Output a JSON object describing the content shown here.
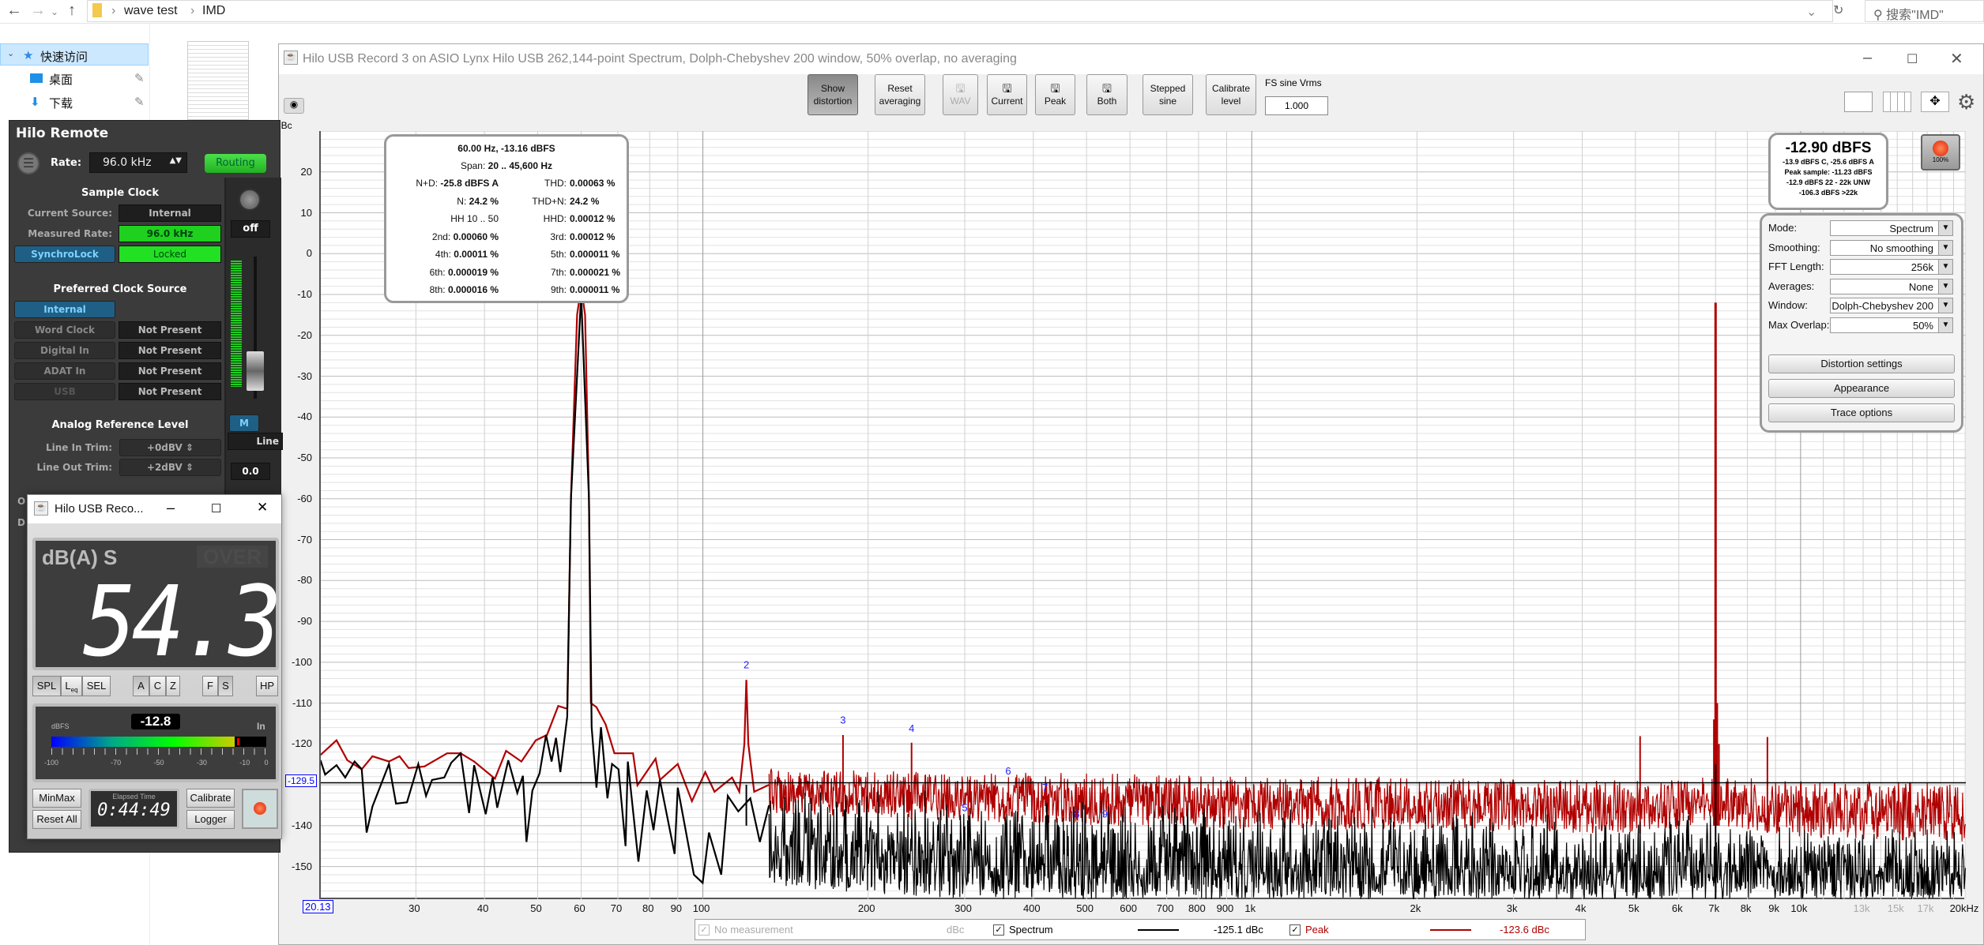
{
  "explorer": {
    "breadcrumb": [
      "wave test",
      "IMD"
    ],
    "search_placeholder": "搜索\"IMD\"",
    "nav": [
      {
        "label": "快速访问",
        "icon": "star-icon"
      },
      {
        "label": "桌面",
        "icon": "desktop-icon"
      },
      {
        "label": "下载",
        "icon": "download-icon"
      }
    ]
  },
  "main": {
    "title": "Hilo USB Record 3 on ASIO Lynx Hilo USB 262,144-point Spectrum, Dolph-Chebyshev 200 window, 50% overlap, no averaging",
    "toolbar": [
      {
        "l1": "Show",
        "l2": "distortion",
        "state": "pressed"
      },
      {
        "l1": "Reset",
        "l2": "averaging",
        "state": "normal"
      },
      {
        "l1": "",
        "l2": "WAV",
        "state": "disabled",
        "icon": "save-icon"
      },
      {
        "l1": "",
        "l2": "Current",
        "state": "normal",
        "icon": "save-icon"
      },
      {
        "l1": "",
        "l2": "Peak",
        "state": "normal",
        "icon": "save-icon"
      },
      {
        "l1": "",
        "l2": "Both",
        "state": "normal",
        "icon": "save-icon"
      },
      {
        "l1": "Stepped",
        "l2": "sine",
        "state": "normal"
      },
      {
        "l1": "Calibrate",
        "l2": "level",
        "state": "normal"
      }
    ],
    "fs_label": "FS sine Vrms",
    "fs_value": "1.000",
    "distortion": {
      "header": "60.00 Hz, -13.16 dBFS",
      "span_label": "Span:",
      "span": "20 .. 45,600 Hz",
      "rows": [
        [
          {
            "k": "N+D:",
            "v": "-25.8 dBFS A"
          },
          {
            "k": "THD:",
            "v": "0.00063 %"
          }
        ],
        [
          {
            "k": "N:",
            "v": "24.2 %"
          },
          {
            "k": "THD+N:",
            "v": "24.2 %"
          }
        ],
        [
          {
            "k": "HH 10 .. 50",
            "v": ""
          },
          {
            "k": "HHD:",
            "v": "0.00012 %"
          }
        ],
        [
          {
            "k": "2nd:",
            "v": "0.00060 %"
          },
          {
            "k": "3rd:",
            "v": "0.00012 %"
          }
        ],
        [
          {
            "k": "4th:",
            "v": "0.00011 %"
          },
          {
            "k": "5th:",
            "v": "0.000011 %"
          }
        ],
        [
          {
            "k": "6th:",
            "v": "0.000019 %"
          },
          {
            "k": "7th:",
            "v": "0.000021 %"
          }
        ],
        [
          {
            "k": "8th:",
            "v": "0.000016 %"
          },
          {
            "k": "9th:",
            "v": "0.000011 %"
          }
        ]
      ]
    },
    "level": {
      "main": "-12.90 dBFS",
      "lines": [
        "-13.9 dBFS C, -25.6 dBFS A",
        "Peak sample: -11.23 dBFS",
        "-12.9 dBFS 22 - 22k UNW",
        "-106.3 dBFS >22k"
      ]
    },
    "record_pct": "100%",
    "controls": [
      {
        "label": "Mode:",
        "value": "Spectrum"
      },
      {
        "label": "Smoothing:",
        "value": "No  smoothing"
      },
      {
        "label": "FFT Length:",
        "value": "256k"
      },
      {
        "label": "Averages:",
        "value": "None"
      },
      {
        "label": "Window:",
        "value": "Dolph-Chebyshev 200"
      },
      {
        "label": "Max Overlap:",
        "value": "50%"
      }
    ],
    "panel_buttons": [
      "Distortion settings",
      "Appearance",
      "Trace options"
    ],
    "legend": {
      "none_label": "No measurement",
      "none_unit": "dBc",
      "items": [
        {
          "name": "Spectrum",
          "value": "-125.1 dBc",
          "color": "#000000",
          "checked": true
        },
        {
          "name": "Peak",
          "value": "-123.6 dBc",
          "color": "#b00000",
          "checked": true
        }
      ]
    }
  },
  "chart_data": {
    "type": "line",
    "xscale": "log",
    "xlim": [
      20.13,
      20000
    ],
    "ylim": [
      -158,
      30
    ],
    "grid": true,
    "ylabel": "dBc",
    "y_ticks": [
      20,
      10,
      0,
      -10,
      -20,
      -30,
      -40,
      -50,
      -60,
      -70,
      -80,
      -90,
      -100,
      -110,
      -120,
      -140,
      -150
    ],
    "x_ticks": [
      {
        "v": 30,
        "label": "30"
      },
      {
        "v": 40,
        "label": "40"
      },
      {
        "v": 50,
        "label": "50"
      },
      {
        "v": 60,
        "label": "60"
      },
      {
        "v": 70,
        "label": "70"
      },
      {
        "v": 80,
        "label": "80"
      },
      {
        "v": 90,
        "label": "90"
      },
      {
        "v": 100,
        "label": "100"
      },
      {
        "v": 200,
        "label": "200"
      },
      {
        "v": 300,
        "label": "300"
      },
      {
        "v": 400,
        "label": "400"
      },
      {
        "v": 500,
        "label": "500"
      },
      {
        "v": 600,
        "label": "600"
      },
      {
        "v": 700,
        "label": "700"
      },
      {
        "v": 800,
        "label": "800"
      },
      {
        "v": 900,
        "label": "900"
      },
      {
        "v": 1000,
        "label": "1k"
      },
      {
        "v": 2000,
        "label": "2k"
      },
      {
        "v": 3000,
        "label": "3k"
      },
      {
        "v": 4000,
        "label": "4k"
      },
      {
        "v": 5000,
        "label": "5k"
      },
      {
        "v": 6000,
        "label": "6k"
      },
      {
        "v": 7000,
        "label": "7k"
      },
      {
        "v": 8000,
        "label": "8k"
      },
      {
        "v": 9000,
        "label": "9k"
      },
      {
        "v": 10000,
        "label": "10k"
      },
      {
        "v": 13000,
        "label": "13k",
        "dim": true
      },
      {
        "v": 15000,
        "label": "15k",
        "dim": true
      },
      {
        "v": 17000,
        "label": "17k",
        "dim": true
      },
      {
        "v": 20000,
        "label": "20kHz"
      }
    ],
    "reference_line": {
      "value": -129.5,
      "label": "-129.5"
    },
    "x_cursor": {
      "value": 20.13,
      "label": "20.13"
    },
    "series": [
      {
        "name": "Peak",
        "color": "#b00000",
        "points": [
          [
            20.1,
            -122.7
          ],
          [
            21.5,
            -119.1
          ],
          [
            22.5,
            -124
          ],
          [
            23.9,
            -126.2
          ],
          [
            25,
            -123
          ],
          [
            26.8,
            -124.3
          ],
          [
            28,
            -123
          ],
          [
            29.1,
            -125.9
          ],
          [
            31.1,
            -125.5
          ],
          [
            34.2,
            -122.3
          ],
          [
            36.2,
            -122.3
          ],
          [
            38.3,
            -124.3
          ],
          [
            41.8,
            -128.5
          ],
          [
            43.8,
            -121.7
          ],
          [
            46.7,
            -124.3
          ],
          [
            49.6,
            -119.1
          ],
          [
            52,
            -117.8
          ],
          [
            54.5,
            -110.7
          ],
          [
            56.6,
            -111.4
          ],
          [
            57.5,
            -60
          ],
          [
            59,
            -15
          ],
          [
            60,
            -8
          ],
          [
            61,
            -15
          ],
          [
            62,
            -60
          ],
          [
            62.5,
            -110
          ],
          [
            64,
            -111
          ],
          [
            66.5,
            -115.2
          ],
          [
            69,
            -122.3
          ],
          [
            74.6,
            -122.3
          ],
          [
            76,
            -130.1
          ],
          [
            82,
            -123.6
          ],
          [
            83.5,
            -128.8
          ],
          [
            90,
            -124.9
          ],
          [
            95.5,
            -134
          ],
          [
            101,
            -126.9
          ],
          [
            105,
            -131.7
          ],
          [
            113,
            -128.2
          ],
          [
            116.5,
            -131.7
          ],
          [
            119,
            -120
          ],
          [
            120,
            -104.3
          ],
          [
            121,
            -120
          ],
          [
            124,
            -131.7
          ],
          [
            132,
            -130
          ]
        ],
        "noise_band": [
          [
            132,
            -126,
            -137
          ],
          [
            300,
            -127,
            -139
          ],
          [
            500,
            -127,
            -140
          ],
          [
            1000,
            -128,
            -141
          ],
          [
            2000,
            -128,
            -141
          ],
          [
            5000,
            -129,
            -142
          ],
          [
            6800,
            -128,
            -140
          ],
          [
            7200,
            -128,
            -140
          ],
          [
            10000,
            -129,
            -143
          ],
          [
            20000,
            -129,
            -144
          ]
        ],
        "spikes": [
          [
            180,
            -117.8
          ],
          [
            240,
            -119.7
          ],
          [
            5100,
            -118.1
          ],
          [
            6950,
            -114
          ],
          [
            7000,
            -12
          ],
          [
            7050,
            -110
          ],
          [
            7100,
            -120
          ],
          [
            8700,
            -118.3
          ]
        ]
      },
      {
        "name": "Spectrum",
        "color": "#000000",
        "points": [
          [
            20.1,
            -124
          ],
          [
            20.5,
            -127.5
          ],
          [
            21.5,
            -125.2
          ],
          [
            22.3,
            -128.2
          ],
          [
            23.2,
            -124.3
          ],
          [
            23.9,
            -126.2
          ],
          [
            24.4,
            -141.7
          ],
          [
            25,
            -135.3
          ],
          [
            26.8,
            -124.9
          ],
          [
            27.6,
            -134.6
          ],
          [
            28.9,
            -134.3
          ],
          [
            30.3,
            -124.9
          ],
          [
            31.3,
            -132.7
          ],
          [
            32.1,
            -128.8
          ],
          [
            33.8,
            -128.2
          ],
          [
            34.8,
            -124.6
          ],
          [
            36.2,
            -122.3
          ],
          [
            37.5,
            -136.9
          ],
          [
            38.3,
            -125.2
          ],
          [
            40.2,
            -137.2
          ],
          [
            41.4,
            -128.2
          ],
          [
            42.2,
            -135.6
          ],
          [
            44.2,
            -124
          ],
          [
            45.9,
            -132
          ],
          [
            47,
            -127.8
          ],
          [
            47.7,
            -144
          ],
          [
            48.9,
            -131.4
          ],
          [
            50.4,
            -127.2
          ],
          [
            51.8,
            -117.8
          ],
          [
            53,
            -124.3
          ],
          [
            54,
            -118.5
          ],
          [
            55,
            -126.9
          ],
          [
            56.6,
            -113.3
          ],
          [
            57.5,
            -60
          ],
          [
            60,
            -10
          ],
          [
            62,
            -60
          ],
          [
            62.7,
            -115.9
          ],
          [
            64,
            -130.7
          ],
          [
            65.2,
            -115.9
          ],
          [
            67,
            -133.3
          ],
          [
            68.3,
            -124.9
          ],
          [
            70.2,
            -126.2
          ],
          [
            72.3,
            -145
          ],
          [
            73,
            -124.3
          ],
          [
            76.3,
            -148.8
          ],
          [
            79,
            -131.4
          ],
          [
            81.3,
            -141.1
          ],
          [
            83.5,
            -128.8
          ],
          [
            88.8,
            -146.9
          ],
          [
            90,
            -130.7
          ],
          [
            96.3,
            -152
          ],
          [
            99.9,
            -154
          ],
          [
            102.6,
            -141.7
          ],
          [
            108,
            -152
          ],
          [
            111,
            -132.7
          ],
          [
            116,
            -136.5
          ],
          [
            122,
            -133.3
          ],
          [
            127,
            -144
          ],
          [
            132,
            -135
          ]
        ],
        "noise_band": [
          [
            132,
            -129,
            -155
          ],
          [
            300,
            -132,
            -158
          ],
          [
            1000,
            -134,
            -158
          ],
          [
            2000,
            -136,
            -158
          ],
          [
            5000,
            -138,
            -158
          ],
          [
            6800,
            -137,
            -158
          ],
          [
            7200,
            -139,
            -158
          ],
          [
            20000,
            -141,
            -158
          ]
        ],
        "spikes": [
          [
            120,
            -130
          ],
          [
            7000,
            -125
          ]
        ]
      }
    ],
    "harmonic_markers": [
      {
        "label": "2",
        "freq": 120,
        "db": -101.5
      },
      {
        "label": "3",
        "freq": 180,
        "db": -115
      },
      {
        "label": "4",
        "freq": 240,
        "db": -117
      },
      {
        "label": "5",
        "freq": 300,
        "db": -136.5
      },
      {
        "label": "6",
        "freq": 360,
        "db": -127.5
      },
      {
        "label": "7",
        "freq": 420,
        "db": -131.5
      },
      {
        "label": "8",
        "freq": 480,
        "db": -138
      },
      {
        "label": "9",
        "freq": 540,
        "db": -138
      }
    ]
  },
  "remote": {
    "title": "Hilo Remote",
    "rate_label": "Rate:",
    "rate": "96.0 kHz",
    "routing": "Routing",
    "sample_clock": "Sample Clock",
    "current_source_label": "Current Source:",
    "current_source": "Internal",
    "measured_rate_label": "Measured Rate:",
    "measured_rate": "96.0 kHz",
    "synchrolock": "SynchroLock",
    "locked": "Locked",
    "preferred": "Preferred Clock Source",
    "pref_internal": "Internal",
    "sources": [
      {
        "name": "Word Clock",
        "status": "Not Present"
      },
      {
        "name": "Digital In",
        "status": "Not Present"
      },
      {
        "name": "ADAT In",
        "status": "Not Present"
      },
      {
        "name": "USB",
        "status": "Not Present"
      }
    ],
    "analog": "Analog Reference Level",
    "line_in_label": "Line In Trim:",
    "line_in": "+0dBV",
    "line_out_label": "Line Out Trim:",
    "line_out": "+2dBV",
    "strip": {
      "pan": "off",
      "mute": "M",
      "input": "Line",
      "gain": "0.0"
    }
  },
  "meter": {
    "title": "Hilo USB Reco...",
    "mode": "dB(A) S",
    "over": "OVER",
    "value": "54.3",
    "buttons_a": [
      "SPL",
      "L",
      "SEL"
    ],
    "leq_sub": "eq",
    "buttons_b": [
      "A",
      "C",
      "Z"
    ],
    "buttons_c": [
      "F",
      "S"
    ],
    "hp": "HP",
    "dbfs_label": "dBFS",
    "dbfs_value": "-12.8",
    "in_label": "In",
    "bar_level_dbfs": -12.8,
    "scale": [
      "-100",
      "-70",
      "-50",
      "-30",
      "-10",
      "0"
    ],
    "minmax": "MinMax",
    "reset": "Reset All",
    "elapsed_label": "Elapsed Time",
    "elapsed": "0:44:49",
    "calibrate": "Calibrate",
    "logger": "Logger"
  }
}
